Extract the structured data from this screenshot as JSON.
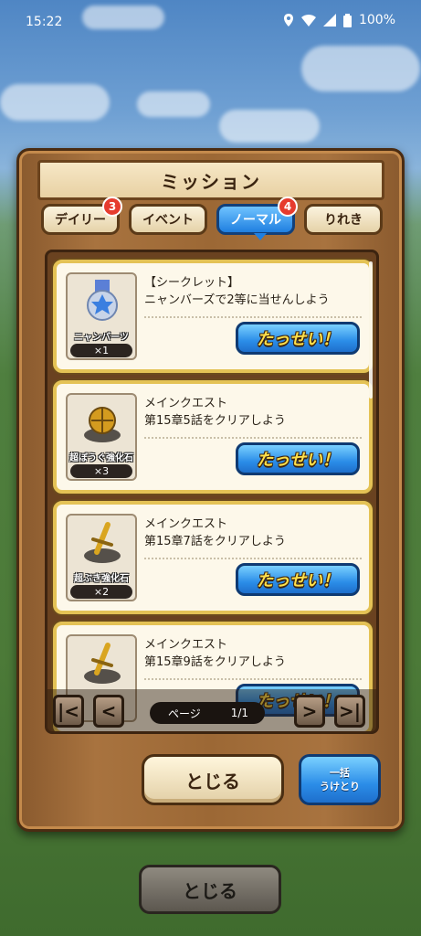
{
  "status_bar": {
    "time": "15:22",
    "battery": "100%"
  },
  "panel": {
    "title": "ミッション"
  },
  "tabs": [
    {
      "label": "デイリー",
      "badge": "3",
      "active": false
    },
    {
      "label": "イベント",
      "badge": "",
      "active": false
    },
    {
      "label": "ノーマル",
      "badge": "4",
      "active": true
    },
    {
      "label": "りれき",
      "badge": "",
      "active": false
    }
  ],
  "missions": [
    {
      "reward_name": "ニャンバーツー！",
      "reward_qty": "×1",
      "line1": "【シークレット】",
      "line2": "ニャンバーズで2等に当せんしよう",
      "button": "たっせい！",
      "icon": "medal-icon"
    },
    {
      "reward_name": "超ぼうぐ強化石",
      "reward_qty": "×3",
      "line1": "メインクエスト",
      "line2": "第15章5話をクリアしよう",
      "button": "たっせい！",
      "icon": "armor-stone-icon"
    },
    {
      "reward_name": "超ぶき強化石",
      "reward_qty": "×2",
      "line1": "メインクエスト",
      "line2": "第15章7話をクリアしよう",
      "button": "たっせい！",
      "icon": "weapon-stone-icon"
    },
    {
      "reward_name": "",
      "reward_qty": "",
      "line1": "メインクエスト",
      "line2": "第15章9話をクリアしよう",
      "button": "たっせい！",
      "icon": "weapon-stone-icon"
    }
  ],
  "pager": {
    "label": "ページ",
    "value": "1/1",
    "first": "|<",
    "prev": "<",
    "next": ">",
    "last": ">|"
  },
  "footer": {
    "close": "とじる",
    "bulk_line1": "一括",
    "bulk_line2": "うけとり"
  },
  "background": {
    "close": "とじる"
  }
}
